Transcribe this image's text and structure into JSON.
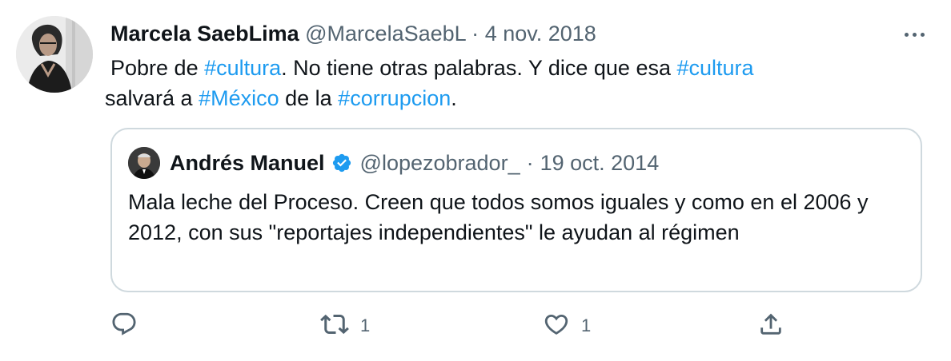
{
  "tweet": {
    "author_name": "Marcela SaebLima",
    "handle": "@MarcelaSaebL",
    "separator": "·",
    "date": "4 nov. 2018",
    "text": {
      "p1": "Pobre de ",
      "tag1": "#cultura",
      "p2": ". No tiene otras palabras.  Y dice que esa ",
      "tag2": "#cultura",
      "p3": " salvará a ",
      "tag3": "#México",
      "p4": " de la ",
      "tag4": "#corrupcion",
      "p5": "."
    }
  },
  "quoted": {
    "author_name": "Andrés Manuel",
    "handle": "@lopezobrador_",
    "separator": "·",
    "date": "19 oct. 2014",
    "text": "Mala leche del Proceso. Creen que todos somos iguales y como en el 2006 y 2012, con sus \"reportajes independientes\" le ayudan al régimen"
  },
  "actions": {
    "reply_count": "",
    "retweet_count": "1",
    "like_count": "1"
  },
  "icons": [
    "more-icon",
    "verified-icon",
    "reply-icon",
    "retweet-icon",
    "like-icon",
    "share-icon"
  ],
  "colors": {
    "link": "#1d9bf0",
    "muted": "#536471",
    "text": "#0f1419",
    "border": "#cfd9de"
  }
}
